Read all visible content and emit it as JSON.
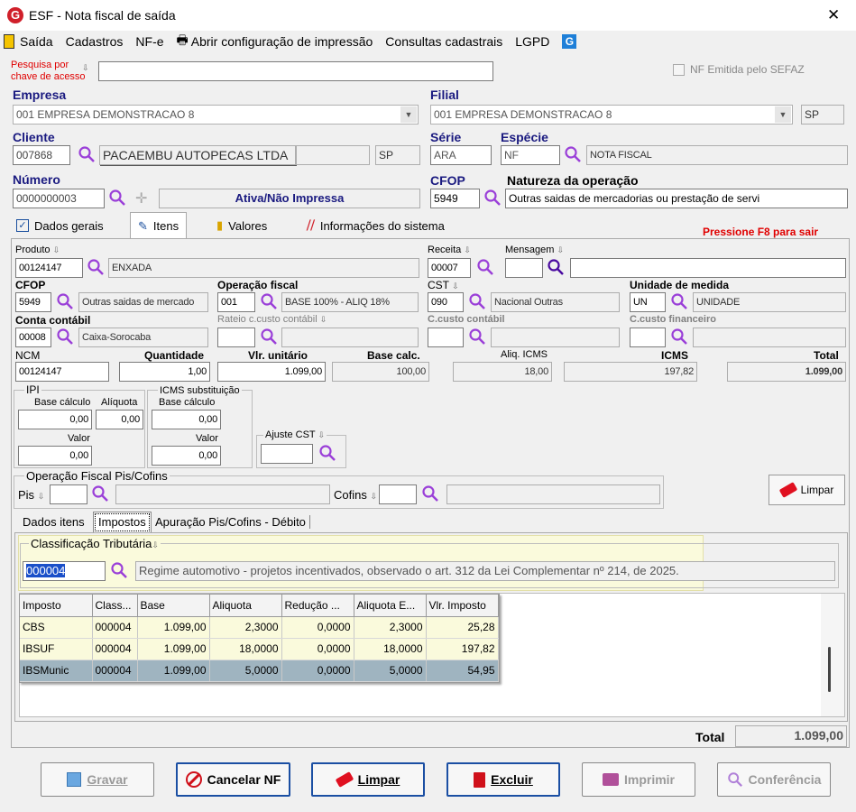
{
  "window": {
    "title": "ESF - Nota fiscal de saída",
    "close": "✕"
  },
  "menu": {
    "sair": "Saída",
    "cadastros": "Cadastros",
    "nfe": "NF-e",
    "abrir": "Abrir configuração de impressão",
    "consultas": "Consultas cadastrais",
    "lgpd": "LGPD"
  },
  "search": {
    "label1": "Pesquisa por",
    "label2": "chave de acesso",
    "value": ""
  },
  "sefaz": {
    "label": "NF Emitida pelo SEFAZ"
  },
  "empresa": {
    "label": "Empresa",
    "value": "001 EMPRESA DEMONSTRACAO 8"
  },
  "filial": {
    "label": "Filial",
    "value": "001 EMPRESA DEMONSTRACAO 8",
    "uf": "SP"
  },
  "cliente": {
    "label": "Cliente",
    "code": "007868",
    "name": "PACAEMBU AUTOPECAS LTDA",
    "uf": "SP"
  },
  "serie": {
    "label": "Série",
    "value": "ARA"
  },
  "especie": {
    "label": "Espécie",
    "code": "NF",
    "desc": "NOTA FISCAL"
  },
  "numero": {
    "label": "Número",
    "value": "0000000003",
    "status": "Ativa/Não Impressa"
  },
  "cfop_top": {
    "label": "CFOP",
    "value": "5949"
  },
  "natureza": {
    "label": "Natureza da operação",
    "value": "Outras saidas de mercadorias ou prestação de servi"
  },
  "tabs": {
    "dados": "Dados gerais",
    "itens": "Itens",
    "valores": "Valores",
    "info": "Informações do sistema",
    "hint": "Pressione F8 para sair"
  },
  "item": {
    "produto_label": "Produto",
    "produto_code": "00124147",
    "produto_name": "ENXADA",
    "receita_label": "Receita",
    "receita": "00007",
    "mensagem_label": "Mensagem",
    "cfop_label": "CFOP",
    "cfop": "5949",
    "cfop_desc": "Outras saidas de mercado",
    "opfiscal_label": "Operação fiscal",
    "opfiscal": "001",
    "opfiscal_desc": "BASE 100% - ALIQ 18%",
    "cst_label": "CST",
    "cst": "090",
    "cst_desc": "Nacional Outras",
    "um_label": "Unidade de medida",
    "um": "UN",
    "um_desc": "UNIDADE",
    "conta_label": "Conta contábil",
    "conta": "00008",
    "conta_desc": "Caixa-Sorocaba",
    "rateio_label": "Rateio c.custo contábil",
    "ccusto_label": "C.custo contábil",
    "ccfin_label": "C.custo financeiro",
    "ncm_label": "NCM",
    "ncm": "00124147",
    "qtd_label": "Quantidade",
    "qtd": "1,00",
    "vlr_label": "Vlr. unitário",
    "vlr": "1.099,00",
    "base_label": "Base calc.",
    "base": "100,00",
    "aliq_label": "Aliq. ICMS",
    "aliq": "18,00",
    "icms_label": "ICMS",
    "icms": "197,82",
    "total_label": "Total",
    "total": "1.099,00"
  },
  "ipi": {
    "title": "IPI",
    "base_label": "Base cálculo",
    "aliq_label": "Alíquota",
    "base": "0,00",
    "aliq": "0,00",
    "valor_label": "Valor",
    "valor": "0,00"
  },
  "icmsst": {
    "title": "ICMS substituição",
    "base_label": "Base cálculo",
    "base": "0,00",
    "valor_label": "Valor",
    "valor": "0,00"
  },
  "ajuste": {
    "label": "Ajuste CST"
  },
  "piscofins": {
    "title": "Operação Fiscal Pis/Cofins",
    "pis": "Pis",
    "cofins": "Cofins"
  },
  "limpar_small": "Limpar",
  "subtabs": {
    "dados": "Dados itens",
    "impostos": "Impostos",
    "apuracao": "Apuração Pis/Cofins - Débito"
  },
  "classif": {
    "title": "Classificação Tributária",
    "code": "000004",
    "desc": "Regime automotivo - projetos incentivados, observado o art. 312 da Lei Complementar nº 214, de 2025."
  },
  "grid": {
    "headers": [
      "Imposto",
      "Class...",
      "Base",
      "Aliquota",
      "Redução ...",
      "Aliquota E...",
      "Vlr. Imposto"
    ],
    "rows": [
      [
        "CBS",
        "000004",
        "1.099,00",
        "2,3000",
        "0,0000",
        "2,3000",
        "25,28"
      ],
      [
        "IBSUF",
        "000004",
        "1.099,00",
        "18,0000",
        "0,0000",
        "18,0000",
        "197,82"
      ],
      [
        "IBSMunic",
        "000004",
        "1.099,00",
        "5,0000",
        "0,0000",
        "5,0000",
        "54,95"
      ]
    ]
  },
  "footer": {
    "total_label": "Total",
    "total": "1.099,00"
  },
  "buttons": {
    "gravar": "Gravar",
    "cancelar": "Cancelar NF",
    "limpar": "Limpar",
    "excluir": "Excluir",
    "imprimir": "Imprimir",
    "conferencia": "Conferência"
  },
  "colors": {
    "brand": "#d0202a",
    "label": "#1a1a80",
    "red_hint": "#e00000",
    "highlight": "#fafadc",
    "purple": "#8a2be2"
  }
}
